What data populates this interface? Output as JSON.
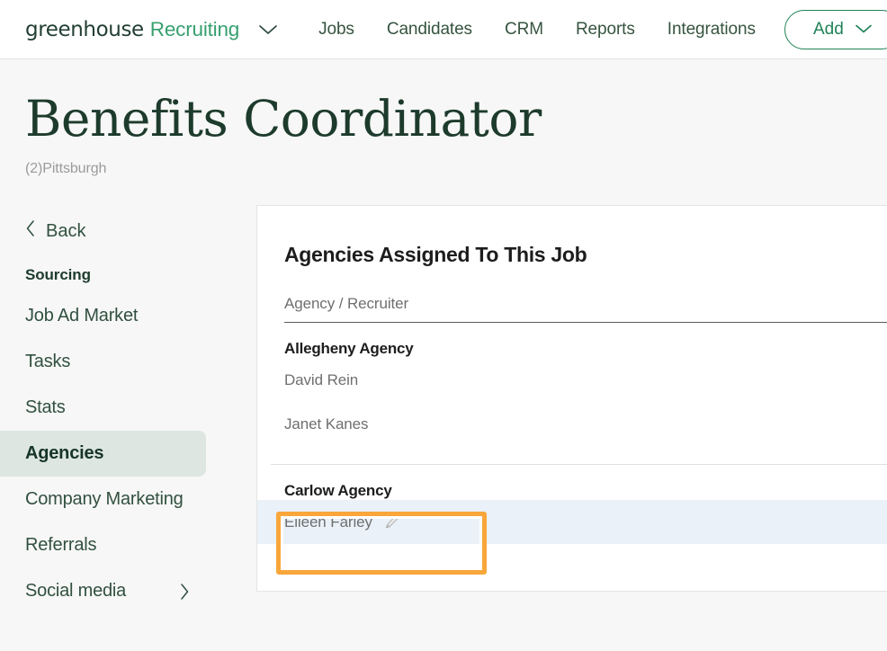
{
  "topnav": {
    "brand_mark": "greenhouse",
    "brand_sub": "Recruiting",
    "brand_caret_icon": "chevron-down-icon",
    "links": [
      {
        "label": "Jobs"
      },
      {
        "label": "Candidates"
      },
      {
        "label": "CRM"
      },
      {
        "label": "Reports"
      },
      {
        "label": "Integrations"
      }
    ],
    "add_button": {
      "label": "Add",
      "caret_icon": "chevron-down-icon"
    }
  },
  "page": {
    "title": "Benefits Coordinator",
    "subtitle": "(2)Pittsburgh"
  },
  "sidebar": {
    "back": {
      "label": "Back",
      "icon": "chevron-left-icon"
    },
    "section_label": "Sourcing",
    "items": [
      {
        "label": "Job Ad Market",
        "active": false,
        "chevron": false
      },
      {
        "label": "Tasks",
        "active": false,
        "chevron": false
      },
      {
        "label": "Stats",
        "active": false,
        "chevron": false
      },
      {
        "label": "Agencies",
        "active": true,
        "chevron": false
      },
      {
        "label": "Company Marketing",
        "active": false,
        "chevron": false
      },
      {
        "label": "Referrals",
        "active": false,
        "chevron": false
      },
      {
        "label": "Social media",
        "active": false,
        "chevron": true
      }
    ]
  },
  "panel": {
    "title": "Agencies Assigned To This Job",
    "column_header": "Agency / Recruiter",
    "groups": [
      {
        "name": "Allegheny Agency",
        "recruiters": [
          {
            "name": "David Rein",
            "hovered": false,
            "edit_icon": false
          },
          {
            "name": "Janet Kanes",
            "hovered": false,
            "edit_icon": false
          }
        ]
      },
      {
        "name": "Carlow Agency",
        "recruiters": [
          {
            "name": "Eileen Farley",
            "hovered": true,
            "edit_icon": true
          }
        ]
      }
    ]
  },
  "annotation": {
    "target": "Eileen Farley",
    "color": "#f9a63a"
  },
  "colors": {
    "brand_green": "#37a06f",
    "title_green": "#1d3b2c",
    "page_bg": "#f7f7f7",
    "active_item_bg": "#dde6e0",
    "row_hover_bg": "#eaf1f8",
    "annotation_orange": "#f9a63a"
  }
}
